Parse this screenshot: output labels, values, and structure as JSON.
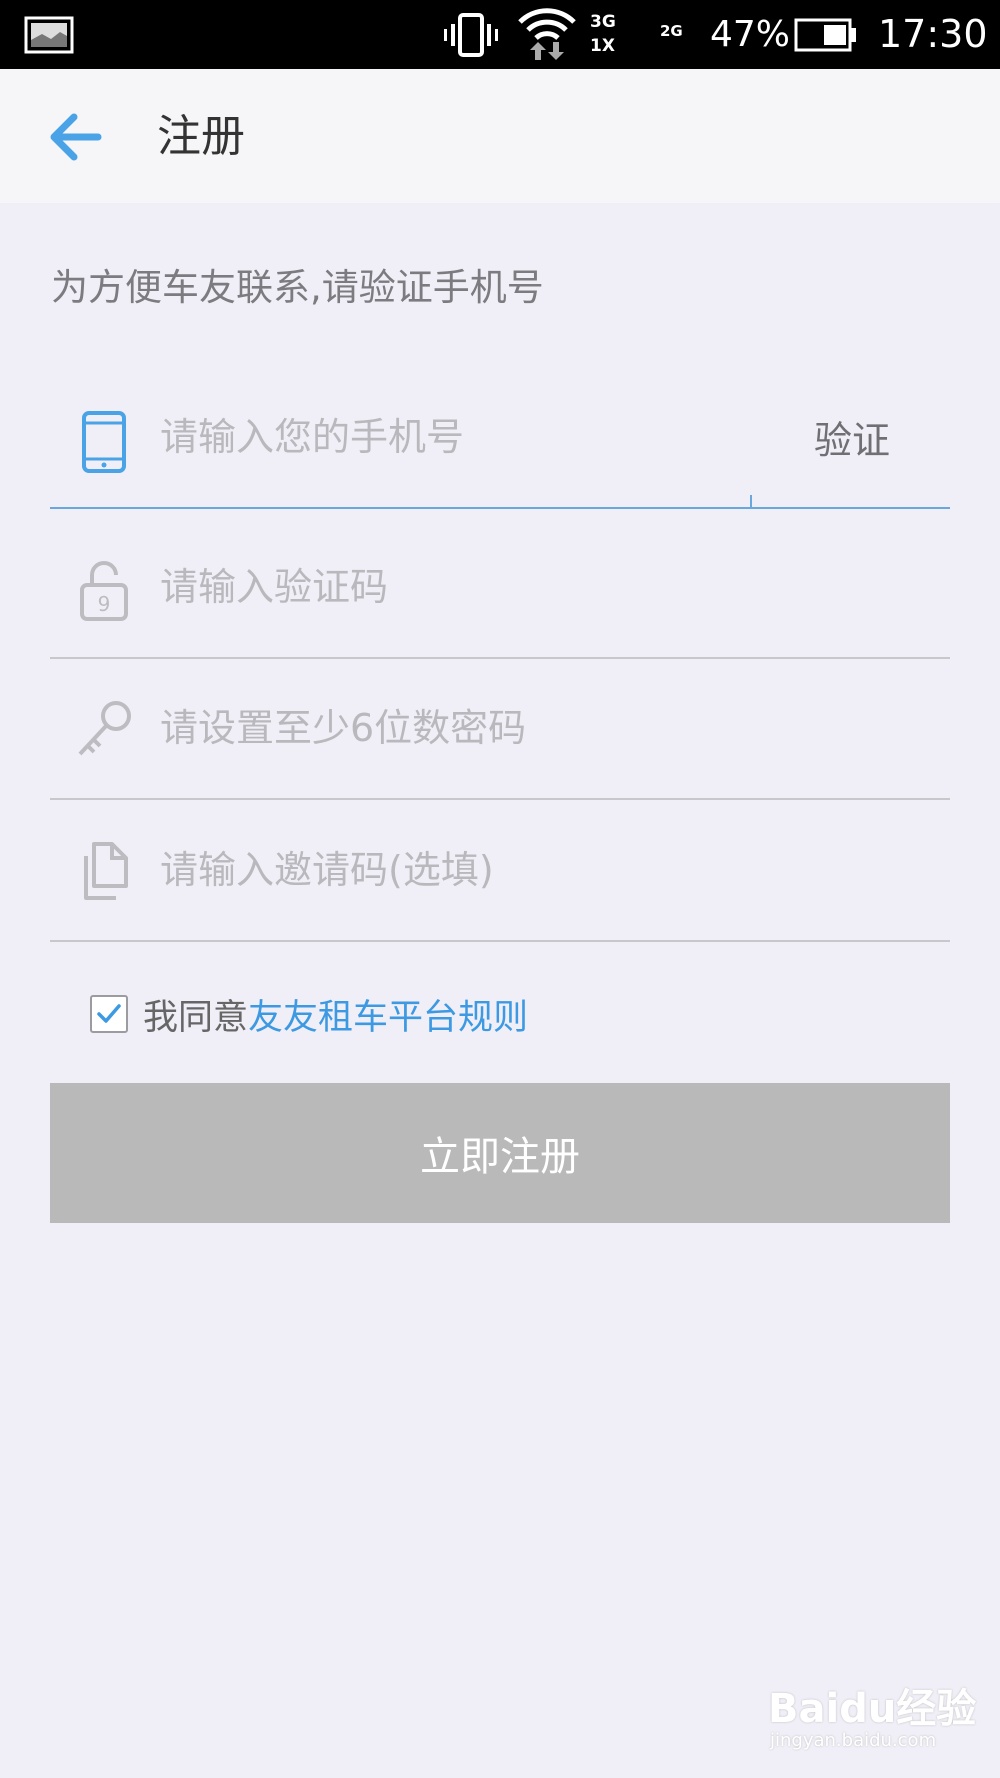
{
  "status_bar": {
    "battery_percent": "47%",
    "time": "17:30",
    "network_primary": "3G",
    "network_secondary": "1X",
    "network_tertiary": "2G"
  },
  "app_bar": {
    "title": "注册"
  },
  "prompt": "为方便车友联系,请验证手机号",
  "form": {
    "phone": {
      "placeholder": "请输入您的手机号",
      "value": ""
    },
    "verify_label": "验证",
    "code": {
      "placeholder": "请输入验证码",
      "value": ""
    },
    "password": {
      "placeholder": "请设置至少6位数密码",
      "value": ""
    },
    "invite": {
      "placeholder": "请输入邀请码(选填)",
      "value": ""
    }
  },
  "agreement": {
    "checked": true,
    "prefix": "我同意",
    "link_text": "友友租车平台规则"
  },
  "submit_label": "立即注册",
  "watermark": {
    "brand": "Baidu经验",
    "url": "jingyan.baidu.com"
  },
  "colors": {
    "accent": "#3c99e2",
    "background": "#f0eff7",
    "button_disabled": "#b9b9b9"
  }
}
